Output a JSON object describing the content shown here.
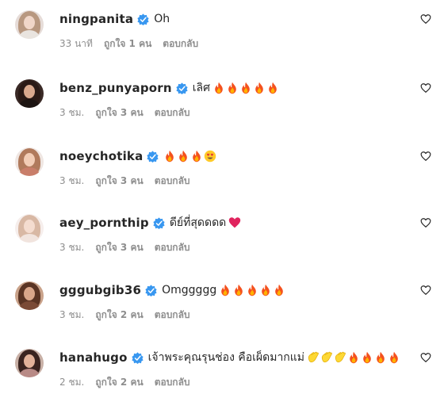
{
  "comments": [
    {
      "username": "ningpanita",
      "text": "Oh",
      "emojis": [],
      "time": "33 นาที",
      "likes": "ถูกใจ 1 คน",
      "reply": "ตอบกลับ",
      "avatar": {
        "bg": "#e6dcd8",
        "hair": "#b89880",
        "face": "#f0d6c8",
        "body": "#e9e4df"
      }
    },
    {
      "username": "benz_punyaporn",
      "text": "เลิศ",
      "emojis": [
        "fire-emoji",
        "fire-emoji",
        "fire-emoji",
        "fire-emoji",
        "fire-emoji"
      ],
      "time": "3 ชม.",
      "likes": "ถูกใจ 3 คน",
      "reply": "ตอบกลับ",
      "avatar": {
        "bg": "#3a2a26",
        "hair": "#2a1a16",
        "face": "#d9a98e",
        "body": "#1c1412"
      }
    },
    {
      "username": "noeychotika",
      "text": "",
      "emojis": [
        "fire-emoji",
        "fire-emoji",
        "fire-emoji",
        "heart-eyes-emoji"
      ],
      "time": "3 ชม.",
      "likes": "ถูกใจ 3 คน",
      "reply": "ตอบกลับ",
      "avatar": {
        "bg": "#efe6e2",
        "hair": "#b07a5c",
        "face": "#f2cdb6",
        "body": "#c97e6a"
      }
    },
    {
      "username": "aey_pornthip",
      "text": "ดีย์ที่สุดดดด",
      "emojis": [
        "red-heart-emoji"
      ],
      "time": "3 ชม.",
      "likes": "ถูกใจ 3 คน",
      "reply": "ตอบกลับ",
      "avatar": {
        "bg": "#f6eeec",
        "hair": "#d8b8a4",
        "face": "#f4dccf",
        "body": "#f1e4de"
      }
    },
    {
      "username": "gggubgib36",
      "text": "Omggggg",
      "emojis": [
        "fire-emoji",
        "fire-emoji",
        "fire-emoji",
        "fire-emoji",
        "fire-emoji"
      ],
      "time": "3 ชม.",
      "likes": "ถูกใจ 2 คน",
      "reply": "ตอบกลับ",
      "avatar": {
        "bg": "#c9a28a",
        "hair": "#5a3424",
        "face": "#d9a68a",
        "body": "#7a4a36"
      }
    },
    {
      "username": "hanahugo",
      "text": "เจ้าพระคุณรุนช่อง คือเผ็ดมากแม่",
      "emojis": [
        "clapping-emoji",
        "clapping-emoji",
        "clapping-emoji",
        "fire-emoji",
        "fire-emoji",
        "fire-emoji",
        "fire-emoji"
      ],
      "time": "2 ชม.",
      "likes": "ถูกใจ 2 คน",
      "reply": "ตอบกลับ",
      "avatar": {
        "bg": "#c8b0a6",
        "hair": "#3a2420",
        "face": "#e2b29a",
        "body": "#b88a86"
      }
    }
  ],
  "colors": {
    "verified": "#3897f0",
    "username": "#262626",
    "meta": "#8e8e8e",
    "heart_outline": "#262626"
  }
}
